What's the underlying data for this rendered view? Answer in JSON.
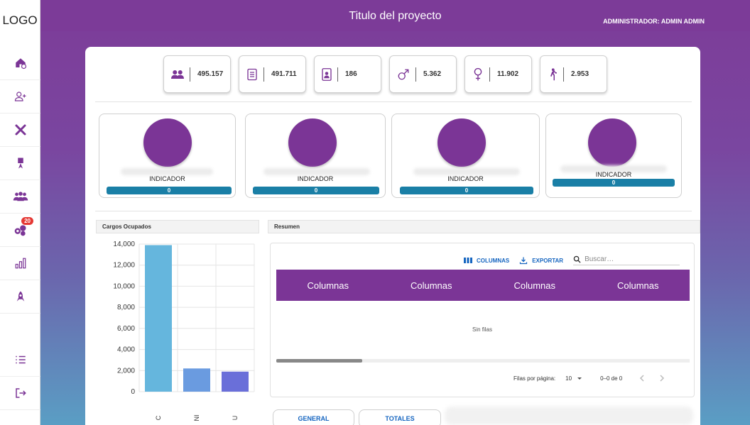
{
  "sidebar": {
    "logo": "LOGO",
    "items": [
      {
        "name": "home-settings-icon"
      },
      {
        "name": "add-user-icon"
      },
      {
        "name": "tools-icon"
      },
      {
        "name": "medal-icon"
      },
      {
        "name": "group-icon"
      },
      {
        "name": "network-icon",
        "badge": "20"
      },
      {
        "name": "bar-chart-icon"
      },
      {
        "name": "rocket-icon"
      }
    ],
    "bottom": [
      {
        "name": "list-icon"
      },
      {
        "name": "logout-icon"
      }
    ]
  },
  "header": {
    "title": "Titulo del proyecto",
    "user": "ADMINISTRADOR: ADMIN ADMIN"
  },
  "stats": [
    {
      "icon": "people-icon",
      "value": "495.157"
    },
    {
      "icon": "document-icon",
      "value": "491.711"
    },
    {
      "icon": "id-badge-icon",
      "value": "186"
    },
    {
      "icon": "male-icon",
      "value": "5.362"
    },
    {
      "icon": "female-icon",
      "value": "11.902"
    },
    {
      "icon": "walking-icon",
      "value": "2.953"
    }
  ],
  "indicators": [
    {
      "label": "INDICADOR",
      "value": "0"
    },
    {
      "label": "INDICADOR",
      "value": "0"
    },
    {
      "label": "INDICADOR",
      "value": "0"
    },
    {
      "label": "INDICADOR",
      "value": "0"
    }
  ],
  "sections": {
    "chart_title": "Cargos Ocupados",
    "summary_title": "Resumen"
  },
  "chart_data": {
    "type": "bar",
    "categories": [
      "C",
      "NI",
      "U"
    ],
    "values": [
      13900,
      2200,
      1900
    ],
    "colors": [
      "#65b6dd",
      "#6a9be0",
      "#6a6fd9"
    ],
    "ylim": [
      0,
      14000
    ],
    "yticks": [
      "0",
      "2,000",
      "4,000",
      "6,000",
      "8,000",
      "10,000",
      "12,000",
      "14,000"
    ],
    "grid": true
  },
  "table": {
    "tools": {
      "columns": "COLUMNAS",
      "export": "EXPORTAR",
      "search_placeholder": "Buscar…"
    },
    "columns": [
      "Columnas",
      "Columnas",
      "Columnas",
      "Columnas"
    ],
    "empty": "Sin filas",
    "pager": {
      "rows_label": "Filas por página:",
      "rows_value": "10",
      "range": "0–0 de 0"
    }
  },
  "tabs": [
    "GENERAL",
    "TOTALES"
  ]
}
